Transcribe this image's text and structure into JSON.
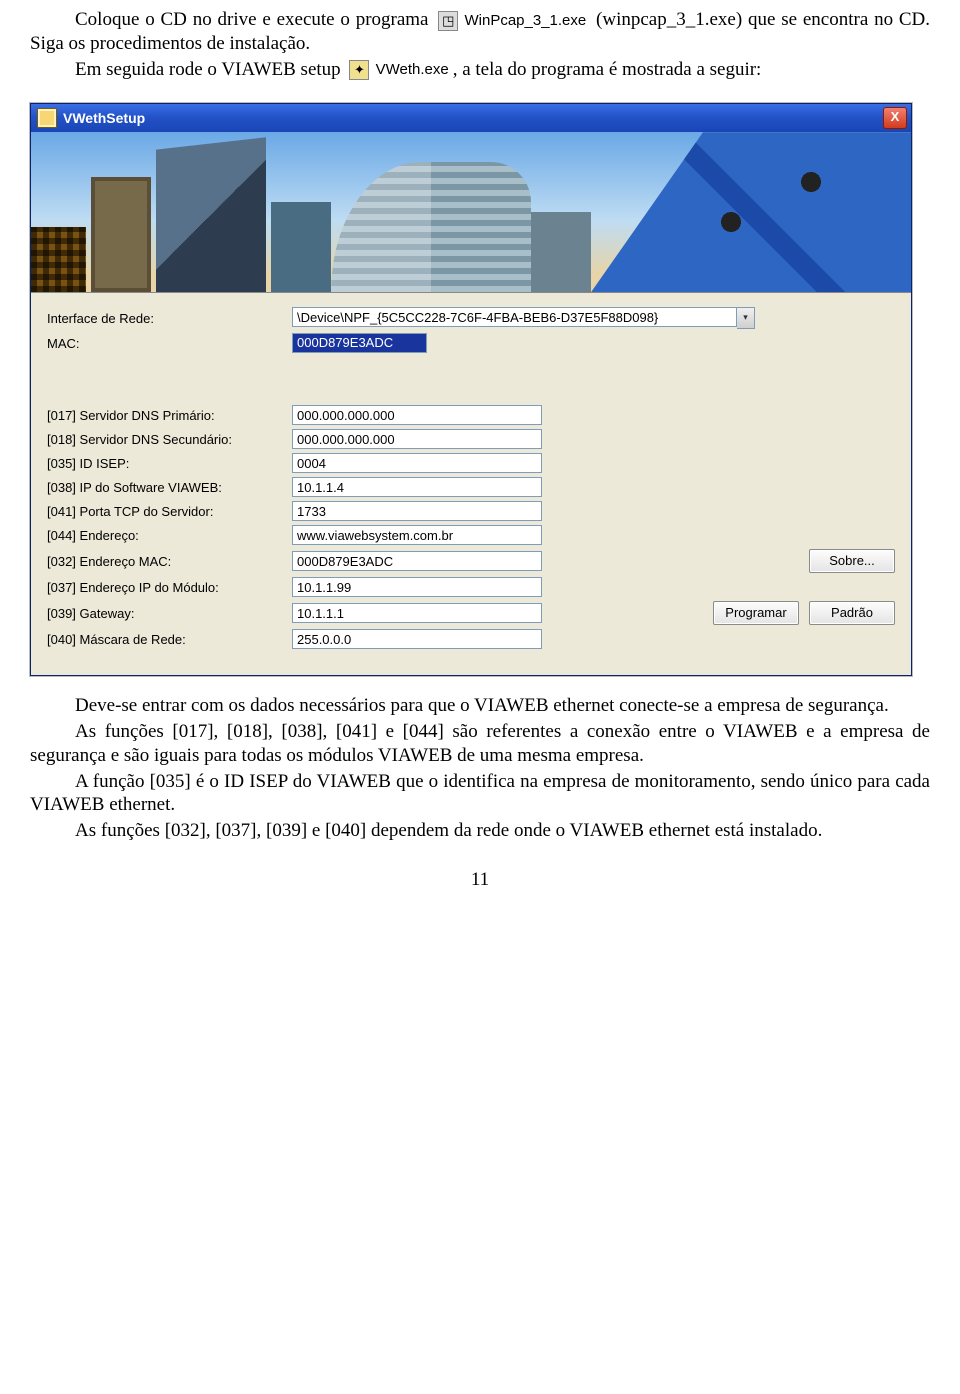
{
  "doc": {
    "p1a": "Coloque o CD no drive e execute o programa",
    "p1b": "(winpcap_3_1.exe) que se encontra no CD. Siga os procedimentos de instalação.",
    "p2a": "Em seguida rode o VIAWEB setup",
    "p2b": ", a tela do programa é mostrada a seguir:",
    "p3": "Deve-se entrar com os dados necessários para que o VIAWEB ethernet conecte-se a empresa de segurança.",
    "p4": "As funções [017], [018], [038], [041] e [044] são referentes a conexão entre o VIAWEB e a empresa de segurança e são iguais para todas os módulos VIAWEB de uma mesma empresa.",
    "p5": "A função [035] é o ID ISEP do VIAWEB que o identifica na empresa de monitoramento, sendo único para cada VIAWEB ethernet.",
    "p6": "As funções [032], [037], [039] e [040] dependem da rede onde o VIAWEB ethernet está instalado.",
    "page_number": "11"
  },
  "inline_files": {
    "winpcap": "WinPcap_3_1.exe",
    "vweth": "VWeth.exe"
  },
  "app": {
    "title": "VWethSetup",
    "close_glyph": "X",
    "labels": {
      "iface": "Interface de Rede:",
      "mac": "MAC:",
      "f017": "[017] Servidor DNS Primário:",
      "f018": "[018] Servidor DNS Secundário:",
      "f035": "[035] ID ISEP:",
      "f038": "[038] IP do Software VIAWEB:",
      "f041": "[041] Porta TCP do Servidor:",
      "f044": "[044] Endereço:",
      "f032": "[032] Endereço MAC:",
      "f037": "[037] Endereço IP do Módulo:",
      "f039": "[039] Gateway:",
      "f040": "[040] Máscara de Rede:"
    },
    "values": {
      "iface": "\\Device\\NPF_{5C5CC228-7C6F-4FBA-BEB6-D37E5F88D098}",
      "mac": "000D879E3ADC",
      "f017": "000.000.000.000",
      "f018": "000.000.000.000",
      "f035": "0004",
      "f038": "10.1.1.4",
      "f041": "1733",
      "f044": "www.viawebsystem.com.br",
      "f032": "000D879E3ADC",
      "f037": "10.1.1.99",
      "f039": "10.1.1.1",
      "f040": "255.0.0.0"
    },
    "buttons": {
      "sobre": "Sobre...",
      "programar": "Programar",
      "padrao": "Padrão"
    },
    "combo_glyph": "▾"
  }
}
